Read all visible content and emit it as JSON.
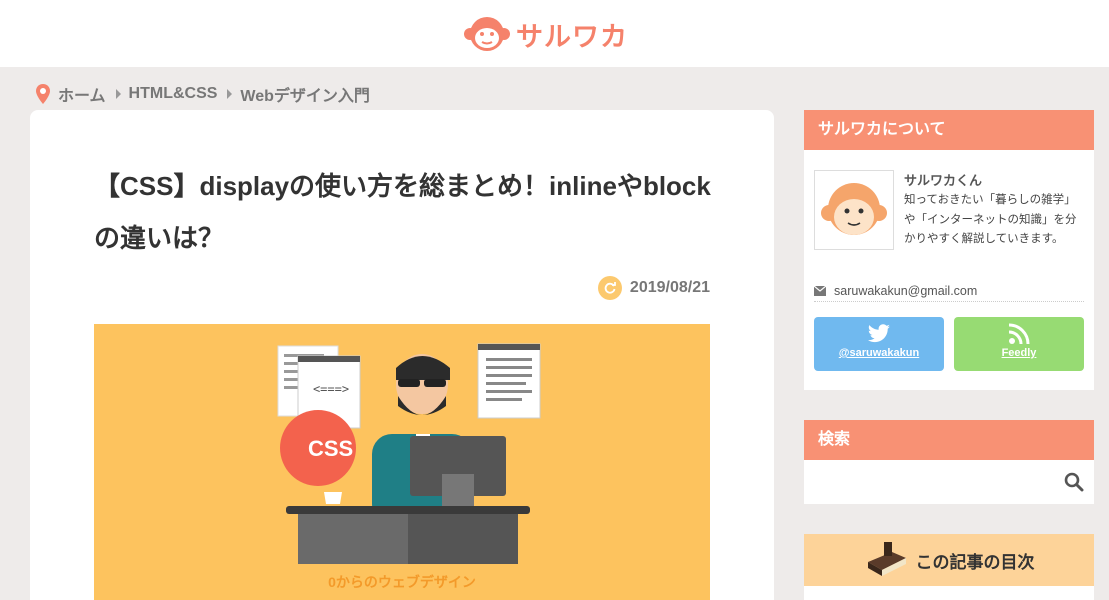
{
  "site": {
    "logo_text": "サルワカ"
  },
  "breadcrumb": {
    "items": [
      "ホーム",
      "HTML&CSS",
      "Webデザイン入門"
    ]
  },
  "post": {
    "title": "【CSS】displayの使い方を総まとめ！inlineやblockの違いは？",
    "date": "2019/08/21",
    "eyecatch_badge": "CSS",
    "eyecatch_code": "<===>",
    "eyecatch_caption": "0からのウェブデザイン"
  },
  "sidebar": {
    "about": {
      "heading": "サルワカについて",
      "name": "サルワカくん",
      "description": "知っておきたい「暮らしの雑学」や「インターネットの知識」を分かりやすく解説していきます。",
      "email": "saruwakakun@gmail.com",
      "twitter_label": "@saruwakakun",
      "feedly_label": "Feedly"
    },
    "search": {
      "heading": "検索",
      "placeholder": ""
    },
    "toc": {
      "heading": "この記事の目次"
    }
  },
  "colors": {
    "accent": "#f89174",
    "twitter": "#70b9ef",
    "feedly": "#97db73",
    "eyecatch_bg": "#fdc35e"
  }
}
